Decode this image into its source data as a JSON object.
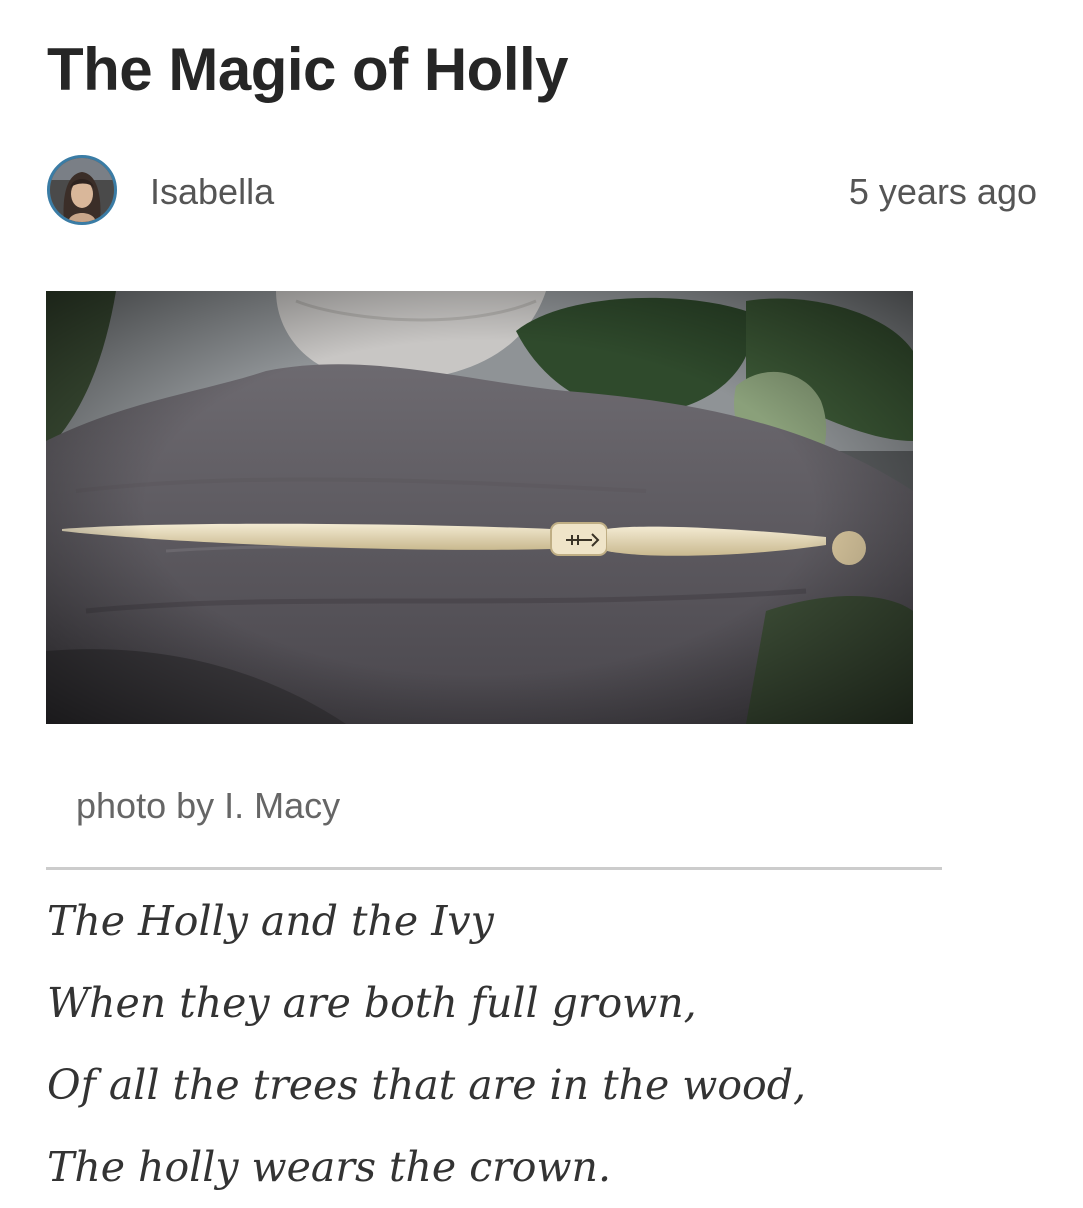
{
  "article": {
    "title": "The Magic of Holly",
    "author": "Isabella",
    "posted": "5 years ago",
    "image": {
      "subject": "holly-wand-photo"
    },
    "caption": "photo by I. Macy",
    "poem": [
      "The Holly and the Ivy",
      "When they are both full grown,",
      "Of all the trees that are in the wood,",
      "The holly wears the crown."
    ]
  }
}
